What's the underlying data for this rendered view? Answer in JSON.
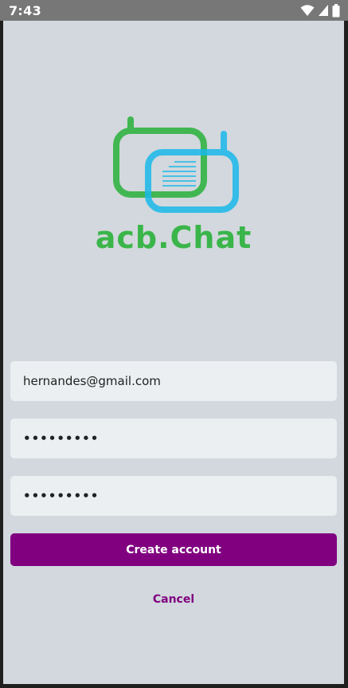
{
  "status_bar": {
    "time": "7:43",
    "icons": [
      "wifi-icon",
      "cell-signal-icon",
      "battery-icon"
    ]
  },
  "logo": {
    "brand_text": "acb.Chat",
    "colors": {
      "green": "#3ab54a",
      "blue": "#1ab8ea"
    }
  },
  "form": {
    "email_value": "hernandes@gmail.com",
    "password_value": "•••••••••",
    "confirm_password_value": "•••••••••",
    "create_label": "Create account",
    "cancel_label": "Cancel"
  },
  "colors": {
    "accent": "#800080",
    "background": "#d2d8dd",
    "field_background": "#ebeff1"
  }
}
